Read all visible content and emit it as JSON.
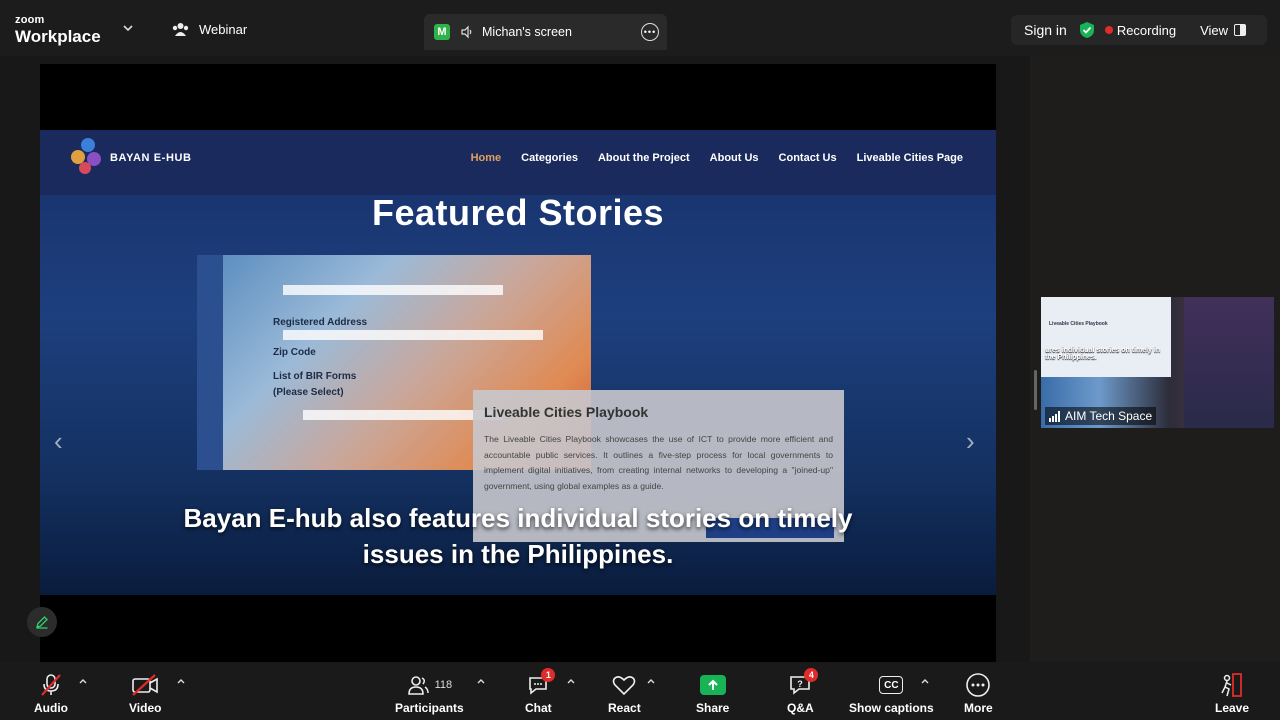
{
  "app": {
    "brand_top": "zoom",
    "brand_bottom": "Workplace",
    "mode": "Webinar"
  },
  "share": {
    "initial": "M",
    "label": "Michan's screen"
  },
  "header": {
    "sign_in": "Sign in",
    "recording": "Recording",
    "view": "View"
  },
  "site": {
    "logo_text": "BAYAN E-HUB",
    "nav": [
      "Home",
      "Categories",
      "About the Project",
      "About Us",
      "Contact Us",
      "Liveable Cities Page"
    ],
    "heading": "Featured Stories",
    "form_labels": [
      "Registered Address",
      "Zip Code",
      "List of BIR Forms",
      "(Please Select)"
    ],
    "card_title": "Liveable Cities Playbook",
    "card_body": "The Liveable Cities Playbook showcases the use of ICT to provide more efficient and accountable public services. It outlines a five-step process for local governments to implement digital initiatives, from creating internal networks to developing a \"joined-up\" government, using global examples as a guide.",
    "caption_line1": "Bayan E-hub also features individual stories on timely",
    "caption_line2": "issues in the Philippines."
  },
  "thumbnail": {
    "name": "AIM Tech Space",
    "screen_title": "Liveable Cities Playbook",
    "screen_caption": "ures individual stories on timely in the Philippines."
  },
  "toolbar": {
    "audio": "Audio",
    "video": "Video",
    "participants": "Participants",
    "participant_count": "118",
    "chat": "Chat",
    "chat_badge": "1",
    "react": "React",
    "share": "Share",
    "qa": "Q&A",
    "qa_badge": "4",
    "captions": "Show captions",
    "captions_icon": "CC",
    "more": "More",
    "leave": "Leave"
  },
  "colors": {
    "accent_green": "#18b356",
    "record_red": "#e02b2b",
    "nav_active": "#e0a060"
  }
}
